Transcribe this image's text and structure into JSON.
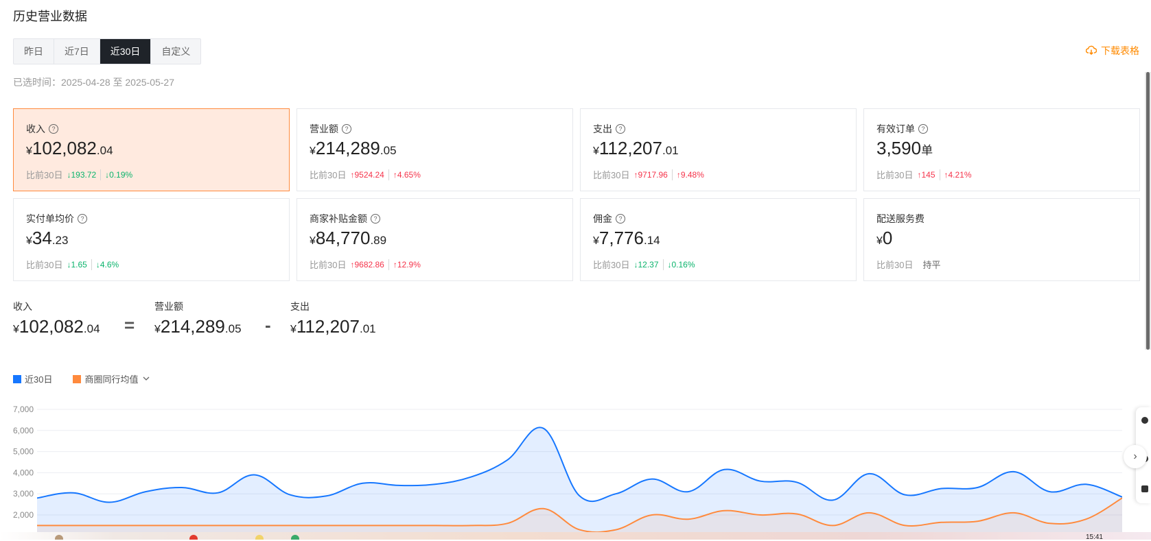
{
  "page": {
    "title": "历史营业数据"
  },
  "tabs": [
    {
      "label": "昨日",
      "active": false
    },
    {
      "label": "近7日",
      "active": false
    },
    {
      "label": "近30日",
      "active": true
    },
    {
      "label": "自定义",
      "active": false
    }
  ],
  "download": {
    "label": "下载表格",
    "icon": "cloud-download-icon"
  },
  "date_range": "已选时间：2025-04-28 至 2025-05-27",
  "compare_label": "比前30日",
  "cards": [
    {
      "label": "收入",
      "currency": "¥",
      "int": "102,082",
      "dec": ".04",
      "unit": "",
      "help": true,
      "delta_abs": "193.72",
      "delta_pct": "0.19%",
      "dir": "down",
      "active": true
    },
    {
      "label": "营业额",
      "currency": "¥",
      "int": "214,289",
      "dec": ".05",
      "unit": "",
      "help": true,
      "delta_abs": "9524.24",
      "delta_pct": "4.65%",
      "dir": "up",
      "active": false
    },
    {
      "label": "支出",
      "currency": "¥",
      "int": "112,207",
      "dec": ".01",
      "unit": "",
      "help": true,
      "delta_abs": "9717.96",
      "delta_pct": "9.48%",
      "dir": "up",
      "active": false
    },
    {
      "label": "有效订单",
      "currency": "",
      "int": "3,590",
      "dec": "",
      "unit": "单",
      "help": true,
      "delta_abs": "145",
      "delta_pct": "4.21%",
      "dir": "up",
      "active": false
    },
    {
      "label": "实付单均价",
      "currency": "¥",
      "int": "34",
      "dec": ".23",
      "unit": "",
      "help": true,
      "delta_abs": "1.65",
      "delta_pct": "4.6%",
      "dir": "down",
      "active": false
    },
    {
      "label": "商家补贴金额",
      "currency": "¥",
      "int": "84,770",
      "dec": ".89",
      "unit": "",
      "help": true,
      "delta_abs": "9682.86",
      "delta_pct": "12.9%",
      "dir": "up",
      "active": false
    },
    {
      "label": "佣金",
      "currency": "¥",
      "int": "7,776",
      "dec": ".14",
      "unit": "",
      "help": true,
      "delta_abs": "12.37",
      "delta_pct": "0.16%",
      "dir": "down",
      "active": false
    },
    {
      "label": "配送服务费",
      "currency": "¥",
      "int": "0",
      "dec": "",
      "unit": "",
      "help": false,
      "flat": "持平",
      "dir": "flat",
      "active": false
    }
  ],
  "formula": {
    "income": {
      "label": "收入",
      "currency": "¥",
      "int": "102,082",
      "dec": ".04"
    },
    "eq": "=",
    "revenue": {
      "label": "营业额",
      "currency": "¥",
      "int": "214,289",
      "dec": ".05"
    },
    "minus": "-",
    "expense": {
      "label": "支出",
      "currency": "¥",
      "int": "112,207",
      "dec": ".01"
    }
  },
  "legend": {
    "series1": "近30日",
    "series2": "商圈同行均值",
    "dropdown_icon": "chevron-down-icon"
  },
  "colors": {
    "accent_orange": "#ff8a00",
    "active_card_bg": "#ffeadf",
    "up": "#f5334a",
    "down": "#09b36b",
    "series1": "#1677ff",
    "series2": "#ff8a3d"
  },
  "chart_data": {
    "type": "area",
    "title": "",
    "xlabel": "",
    "ylabel": "",
    "ylim": [
      2000,
      7000
    ],
    "yticks": [
      "7,000",
      "6,000",
      "5,000",
      "4,000",
      "3,000",
      "2,000"
    ],
    "grid": true,
    "legend_position": "top-left",
    "series": [
      {
        "name": "近30日",
        "color": "#1677ff",
        "values": [
          2800,
          3050,
          2600,
          3100,
          3300,
          3050,
          3900,
          2950,
          2900,
          3500,
          3400,
          3450,
          3800,
          4600,
          6100,
          2900,
          3000,
          3700,
          3100,
          4150,
          3600,
          3550,
          2700,
          3950,
          2950,
          3250,
          3300,
          4050,
          3100,
          3450,
          2850
        ]
      },
      {
        "name": "商圈同行均值",
        "color": "#ff8a3d",
        "values": [
          1500,
          1500,
          1500,
          1500,
          1500,
          1500,
          1500,
          1500,
          1500,
          1500,
          1500,
          1500,
          1500,
          1600,
          2300,
          1300,
          1300,
          2000,
          1800,
          2200,
          2000,
          2050,
          1500,
          2100,
          1500,
          1650,
          1700,
          2100,
          1600,
          1800,
          2800
        ]
      }
    ]
  },
  "taskbar": {
    "time": "15:41"
  }
}
